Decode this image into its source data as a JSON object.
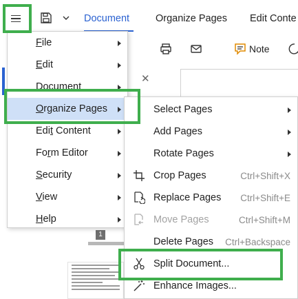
{
  "toolbar": {
    "tabs": [
      {
        "label": "Document"
      },
      {
        "label": "Organize Pages"
      },
      {
        "label": "Edit Conte"
      }
    ],
    "note_label": "Note"
  },
  "page_badge": "1",
  "main_menu": {
    "items": [
      {
        "label": "File",
        "u": "F",
        "rest": "ile"
      },
      {
        "label": "Edit",
        "u": "E",
        "rest": "dit"
      },
      {
        "label": "Document",
        "u": "D",
        "rest": "ocument"
      },
      {
        "label": "Organize Pages",
        "u": "O",
        "rest": "rganize Pages"
      },
      {
        "label": "Edit Content",
        "pre": "Edi",
        "u": "t",
        "rest": " Content"
      },
      {
        "label": "Form Editor",
        "pre": "Fo",
        "u": "r",
        "rest": "m Editor"
      },
      {
        "label": "Security",
        "u": "S",
        "rest": "ecurity"
      },
      {
        "label": "View",
        "u": "V",
        "rest": "iew"
      },
      {
        "label": "Help",
        "u": "H",
        "rest": "elp"
      }
    ]
  },
  "organize_menu": {
    "items": [
      {
        "label": "Select Pages",
        "shortcut": ""
      },
      {
        "label": "Add Pages",
        "shortcut": ""
      },
      {
        "label": "Rotate Pages",
        "shortcut": ""
      },
      {
        "label": "Crop Pages",
        "shortcut": "Ctrl+Shift+X"
      },
      {
        "label": "Replace Pages",
        "shortcut": "Ctrl+Shift+E"
      },
      {
        "label": "Move Pages",
        "shortcut": "Ctrl+Shift+M"
      },
      {
        "label": "Delete Pages",
        "shortcut": "Ctrl+Backspace"
      },
      {
        "label": "Split Document...",
        "shortcut": ""
      },
      {
        "label": "Enhance Images...",
        "shortcut": ""
      }
    ]
  },
  "colors": {
    "accent": "#2b62d1",
    "highlight": "#cfe0f7",
    "annotation_green": "#3fae4d"
  }
}
